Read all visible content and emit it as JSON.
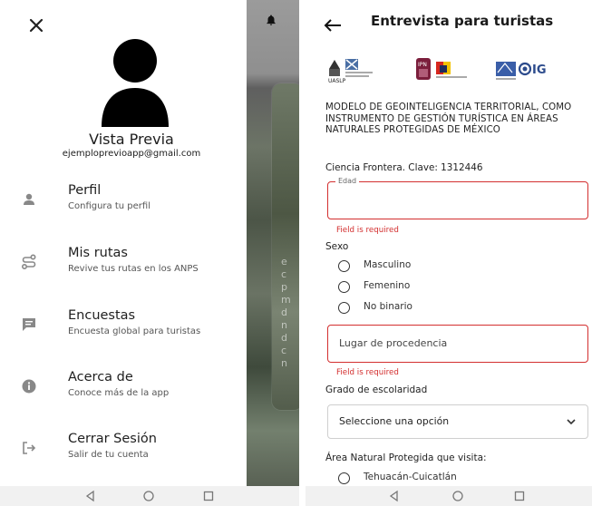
{
  "drawer": {
    "title": "Vista Previa",
    "email": "ejemplopreviоapp@gmail.com",
    "items": [
      {
        "label": "Perfil",
        "sub": "Configura tu perfil",
        "icon": "person-icon"
      },
      {
        "label": "Mis rutas",
        "sub": "Revive tus rutas en los ANPS",
        "icon": "route-icon"
      },
      {
        "label": "Encuestas",
        "sub": "Encuesta global para turistas",
        "icon": "chat-icon"
      },
      {
        "label": "Acerca de",
        "sub": "Conoce más de la app",
        "icon": "info-icon"
      },
      {
        "label": "Cerrar Sesión",
        "sub": "Salir de tu cuenta",
        "icon": "logout-icon"
      }
    ],
    "background_letters": "e\nc\np\nm\nd\nn\nd\nc\nn"
  },
  "form": {
    "title": "Entrevista para turistas",
    "logos": [
      "UASLP",
      "IPN",
      "CentroGeo",
      "UNAM",
      "IG"
    ],
    "heading": "MODELO DE GEOINTELIGENCIA TERRITORIAL, COMO INSTRUMENTO DE GESTIÓN TURÍSTICA EN ÁREAS NATURALES PROTEGIDAS DE MÉXICO",
    "subheading": "Ciencia Frontera. Clave: 1312446",
    "edad": {
      "label": "Edad",
      "error": "Field is required"
    },
    "sexo": {
      "label": "Sexo",
      "options": [
        "Masculino",
        "Femenino",
        "No binario"
      ]
    },
    "lugar": {
      "placeholder": "Lugar de procedencia",
      "error": "Field is required"
    },
    "escolaridad": {
      "label": "Grado de escolaridad",
      "value": "Seleccione una opción"
    },
    "anp": {
      "label": "Área Natural Protegida que visita:",
      "first_option": "Tehuacán-Cuicatlán"
    }
  },
  "colors": {
    "error": "#d32f2f",
    "text": "#1c1c1c",
    "navbar": "#f1f1f1"
  }
}
